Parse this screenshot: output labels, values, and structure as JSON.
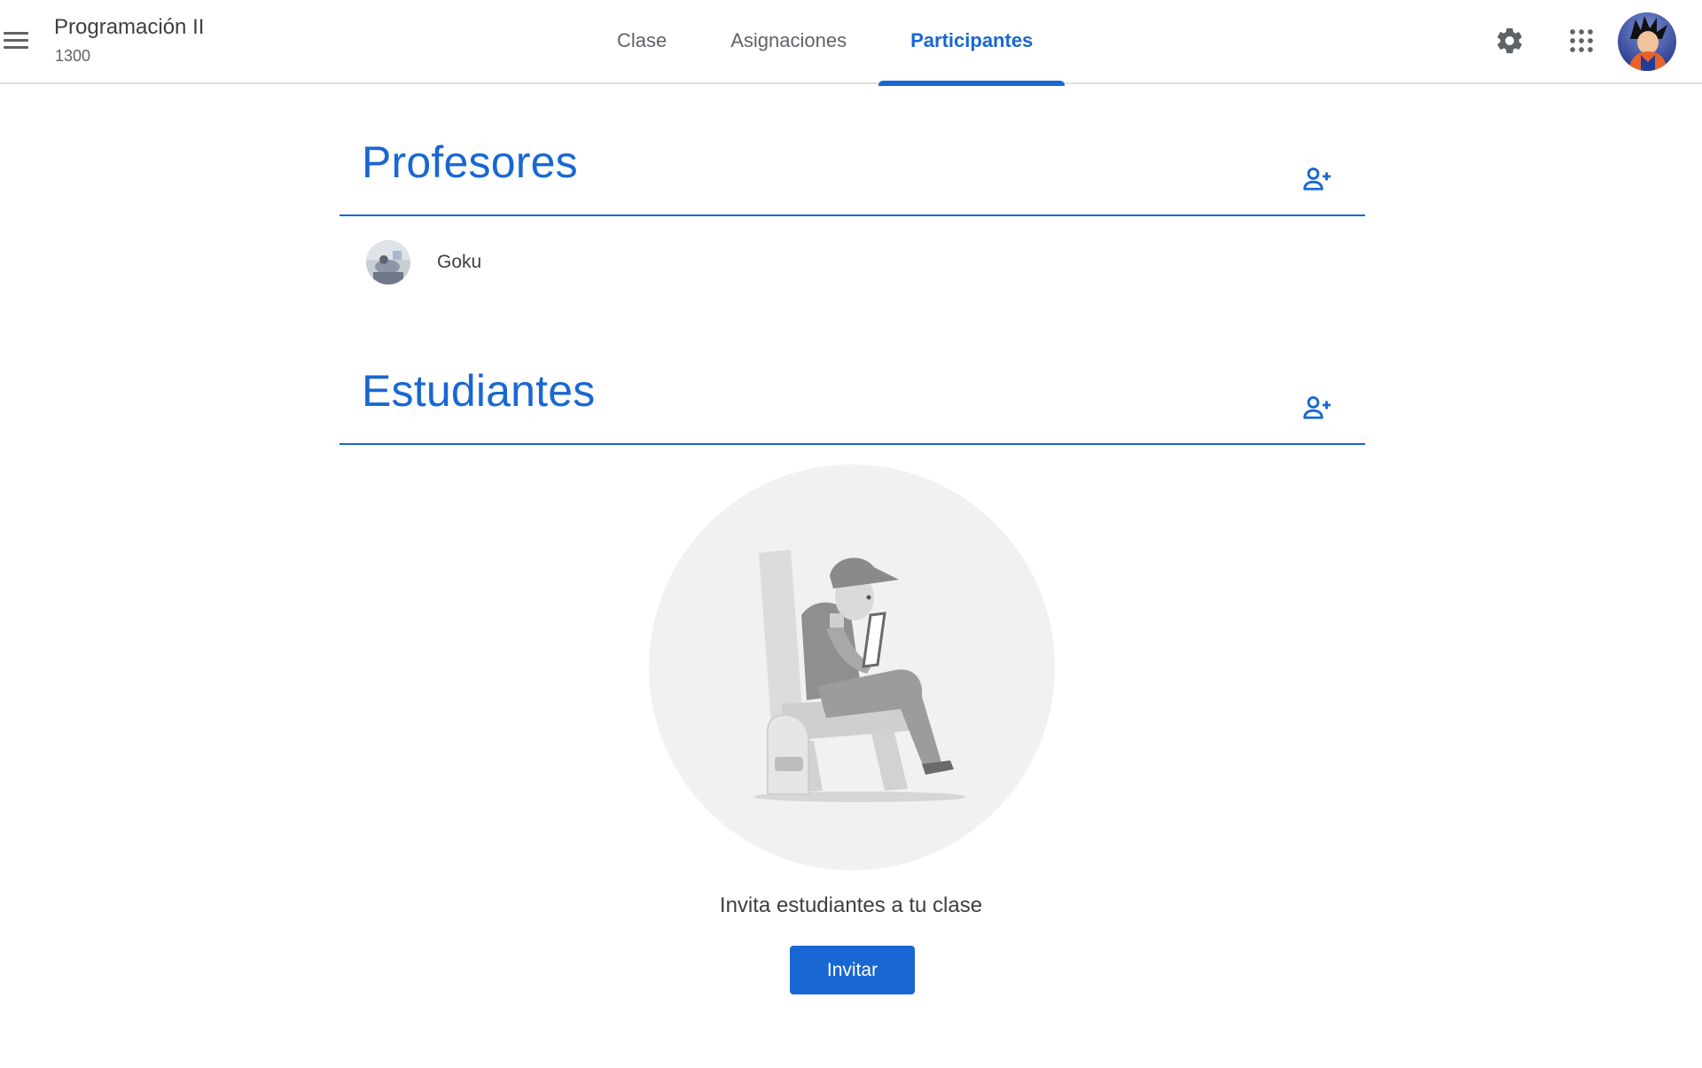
{
  "header": {
    "menu_icon": "hamburger-menu-icon",
    "class_title": "Programación II",
    "class_section": "1300",
    "tabs": [
      {
        "label": "Clase",
        "active": false
      },
      {
        "label": "Asignaciones",
        "active": false
      },
      {
        "label": "Participantes",
        "active": true
      }
    ],
    "settings_icon": "gear-icon",
    "apps_icon": "apps-grid-icon",
    "account_avatar": "user-avatar"
  },
  "teachers": {
    "title": "Profesores",
    "add_icon": "person-add-icon",
    "items": [
      {
        "name": "Goku",
        "avatar": "teacher-avatar"
      }
    ]
  },
  "students": {
    "title": "Estudiantes",
    "add_icon": "person-add-icon",
    "empty_state": {
      "illustration": "student-reading-tablet-illustration",
      "message": "Invita estudiantes a tu clase",
      "button_label": "Invitar"
    }
  },
  "colors": {
    "accent": "#1967d2",
    "text": "#3c4043",
    "muted": "#5f6368",
    "divider": "#e0e0e0"
  }
}
